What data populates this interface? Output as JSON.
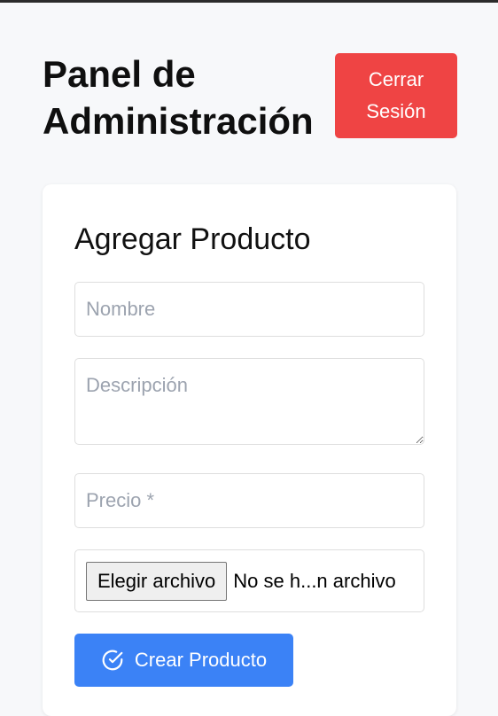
{
  "header": {
    "title": "Panel de Administración",
    "logout_label": "Cerrar Sesión",
    "logout_color": "#ef4444"
  },
  "form": {
    "title": "Agregar Producto",
    "name_placeholder": "Nombre",
    "description_placeholder": "Descripción",
    "price_placeholder": "Precio *",
    "file_button_label": "Elegir archivo",
    "file_status": "No se h...n archivo",
    "submit_label": "Crear Producto",
    "submit_icon": "check-circle-icon",
    "submit_color": "#3b82f6"
  }
}
